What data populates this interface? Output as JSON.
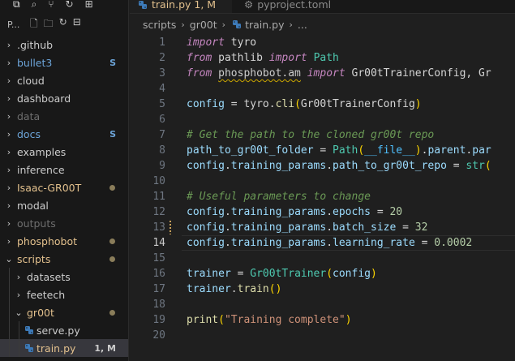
{
  "activity_bar": {
    "icons": [
      "files-icon",
      "search-icon",
      "source-control-icon",
      "refresh-icon",
      "extensions-icon"
    ]
  },
  "explorer": {
    "project_label": "P...",
    "actions": [
      "new-file-icon",
      "new-folder-icon",
      "refresh-icon",
      "collapse-all-icon"
    ],
    "items": [
      {
        "label": ".github",
        "depth": 0,
        "type": "folder",
        "open": false,
        "color": "gray"
      },
      {
        "label": "bullet3",
        "depth": 0,
        "type": "folder",
        "open": false,
        "color": "blue",
        "badge": "S"
      },
      {
        "label": "cloud",
        "depth": 0,
        "type": "folder",
        "open": false,
        "color": "gray"
      },
      {
        "label": "dashboard",
        "depth": 0,
        "type": "folder",
        "open": false,
        "color": "gray"
      },
      {
        "label": "data",
        "depth": 0,
        "type": "folder",
        "open": false,
        "color": "dim"
      },
      {
        "label": "docs",
        "depth": 0,
        "type": "folder",
        "open": false,
        "color": "blue",
        "badge": "S"
      },
      {
        "label": "examples",
        "depth": 0,
        "type": "folder",
        "open": false,
        "color": "gray"
      },
      {
        "label": "inference",
        "depth": 0,
        "type": "folder",
        "open": false,
        "color": "gray"
      },
      {
        "label": "Isaac-GR00T",
        "depth": 0,
        "type": "folder",
        "open": false,
        "color": "mod",
        "dot": true
      },
      {
        "label": "modal",
        "depth": 0,
        "type": "folder",
        "open": false,
        "color": "gray"
      },
      {
        "label": "outputs",
        "depth": 0,
        "type": "folder",
        "open": false,
        "color": "dim"
      },
      {
        "label": "phosphobot",
        "depth": 0,
        "type": "folder",
        "open": false,
        "color": "mod",
        "dot": true
      },
      {
        "label": "scripts",
        "depth": 0,
        "type": "folder",
        "open": true,
        "color": "mod",
        "dot": true
      },
      {
        "label": "datasets",
        "depth": 1,
        "type": "folder",
        "open": false,
        "color": "gray"
      },
      {
        "label": "feetech",
        "depth": 1,
        "type": "folder",
        "open": false,
        "color": "gray"
      },
      {
        "label": "gr00t",
        "depth": 1,
        "type": "folder",
        "open": true,
        "color": "mod",
        "dot": true
      },
      {
        "label": "serve.py",
        "depth": 2,
        "type": "python",
        "color": "gray"
      },
      {
        "label": "train.py",
        "depth": 2,
        "type": "python",
        "color": "mod",
        "badge": "1, M",
        "selected": true
      }
    ]
  },
  "tabs": [
    {
      "label": "train.py",
      "status": "1, M",
      "active": true
    },
    {
      "label": "pyproject.toml",
      "active": false
    }
  ],
  "breadcrumb": [
    "scripts",
    "gr00t",
    "train.py",
    "..."
  ],
  "editor": {
    "current_line": 14,
    "lines": [
      {
        "n": "1",
        "tokens": [
          [
            "kw",
            "import"
          ],
          [
            "dflt",
            " tyro"
          ]
        ]
      },
      {
        "n": "2",
        "tokens": [
          [
            "kw",
            "from"
          ],
          [
            "dflt",
            " pathlib "
          ],
          [
            "kw",
            "import"
          ],
          [
            "dflt",
            " "
          ],
          [
            "cls",
            "Path"
          ]
        ]
      },
      {
        "n": "3",
        "tokens": [
          [
            "kw",
            "from"
          ],
          [
            "dflt",
            " "
          ],
          [
            "squig",
            "phosphobot.am"
          ],
          [
            "dflt",
            " "
          ],
          [
            "kw",
            "import"
          ],
          [
            "dflt",
            " Gr00tTrainerConfig, Gr"
          ]
        ]
      },
      {
        "n": "4",
        "tokens": []
      },
      {
        "n": "5",
        "tokens": [
          [
            "var",
            "config"
          ],
          [
            "dflt",
            " = tyro."
          ],
          [
            "fn",
            "cli"
          ],
          [
            "paren",
            "("
          ],
          [
            "dflt",
            "Gr00tTrainerConfig"
          ],
          [
            "paren",
            ")"
          ]
        ]
      },
      {
        "n": "6",
        "tokens": []
      },
      {
        "n": "7",
        "tokens": [
          [
            "cmt",
            "# Get the path to the cloned gr00t repo"
          ]
        ]
      },
      {
        "n": "8",
        "tokens": [
          [
            "var",
            "path_to_gr00t_folder"
          ],
          [
            "dflt",
            " = "
          ],
          [
            "cls",
            "Path"
          ],
          [
            "paren",
            "("
          ],
          [
            "dunder",
            "__file__"
          ],
          [
            "paren",
            ")"
          ],
          [
            "dflt",
            "."
          ],
          [
            "var",
            "parent"
          ],
          [
            "dflt",
            "."
          ],
          [
            "var",
            "par"
          ]
        ]
      },
      {
        "n": "9",
        "tokens": [
          [
            "var",
            "config"
          ],
          [
            "dflt",
            "."
          ],
          [
            "var",
            "training_params"
          ],
          [
            "dflt",
            "."
          ],
          [
            "var",
            "path_to_gr00t_repo"
          ],
          [
            "dflt",
            " = "
          ],
          [
            "cls",
            "str"
          ],
          [
            "paren",
            "("
          ]
        ]
      },
      {
        "n": "10",
        "tokens": []
      },
      {
        "n": "11",
        "tokens": [
          [
            "cmt",
            "# Useful parameters to change"
          ]
        ]
      },
      {
        "n": "12",
        "tokens": [
          [
            "var",
            "config"
          ],
          [
            "dflt",
            "."
          ],
          [
            "var",
            "training_params"
          ],
          [
            "dflt",
            "."
          ],
          [
            "var",
            "epochs"
          ],
          [
            "dflt",
            " = "
          ],
          [
            "num",
            "20"
          ]
        ]
      },
      {
        "n": "13",
        "tokens": [
          [
            "var",
            "config"
          ],
          [
            "dflt",
            "."
          ],
          [
            "var",
            "training_params"
          ],
          [
            "dflt",
            "."
          ],
          [
            "var",
            "batch_size"
          ],
          [
            "dflt",
            " = "
          ],
          [
            "num",
            "32"
          ]
        ],
        "modified": true
      },
      {
        "n": "14",
        "tokens": [
          [
            "var",
            "config"
          ],
          [
            "dflt",
            "."
          ],
          [
            "var",
            "training_params"
          ],
          [
            "dflt",
            "."
          ],
          [
            "var",
            "learning_rate"
          ],
          [
            "dflt",
            " = "
          ],
          [
            "num",
            "0.0002"
          ]
        ]
      },
      {
        "n": "15",
        "tokens": []
      },
      {
        "n": "16",
        "tokens": [
          [
            "var",
            "trainer"
          ],
          [
            "dflt",
            " = "
          ],
          [
            "cls",
            "Gr00tTrainer"
          ],
          [
            "paren",
            "("
          ],
          [
            "var",
            "config"
          ],
          [
            "paren",
            ")"
          ]
        ]
      },
      {
        "n": "17",
        "tokens": [
          [
            "var",
            "trainer"
          ],
          [
            "dflt",
            "."
          ],
          [
            "fn",
            "train"
          ],
          [
            "paren",
            "()"
          ]
        ]
      },
      {
        "n": "18",
        "tokens": []
      },
      {
        "n": "19",
        "tokens": [
          [
            "fn",
            "print"
          ],
          [
            "paren",
            "("
          ],
          [
            "str",
            "\"Training complete\""
          ],
          [
            "paren",
            ")"
          ]
        ]
      },
      {
        "n": "20",
        "tokens": []
      }
    ]
  }
}
